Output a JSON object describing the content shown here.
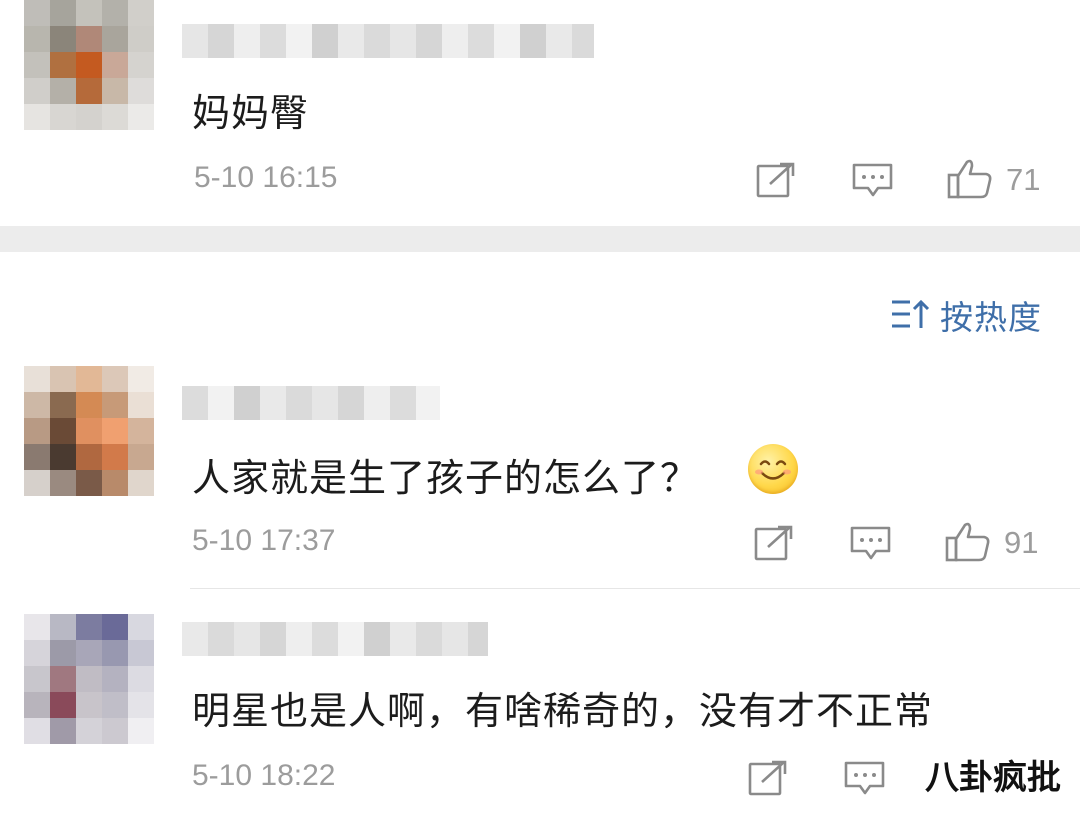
{
  "comments": [
    {
      "text": "妈妈臀",
      "time": "5-10 16:15",
      "likes": "71",
      "avatar_colors": [
        "#bfbdb8",
        "#a6a49c",
        "#c4c2bb",
        "#b3b1aa",
        "#d1cfca",
        "#b8b6ae",
        "#8b857a",
        "#b08878",
        "#a9a59c",
        "#cfcdc8",
        "#c3c1bb",
        "#b07040",
        "#c45a20",
        "#c9a898",
        "#d5d3cf",
        "#d0ceca",
        "#b4b0a8",
        "#b56a3a",
        "#c8b8a8",
        "#dedcda",
        "#e6e4e1",
        "#d8d6d2",
        "#d4d2ce",
        "#dcdad6",
        "#ebeae8"
      ]
    },
    {
      "text": "人家就是生了孩子的怎么了？",
      "time": "5-10 17:37",
      "likes": "91",
      "avatar_colors": [
        "#e8e0d8",
        "#d9c4b2",
        "#e2b896",
        "#dcc8b8",
        "#f1ebe5",
        "#cdb8a6",
        "#8a6a50",
        "#d48a54",
        "#c79a78",
        "#eadfd5",
        "#b89a84",
        "#6a4a36",
        "#e09060",
        "#f0a070",
        "#d4b49c",
        "#8a7a70",
        "#4a3a30",
        "#b06840",
        "#d27a4a",
        "#c8a890",
        "#d6d0cb",
        "#9a8a80",
        "#7a5a48",
        "#b88a6a",
        "#e0d6cc"
      ]
    },
    {
      "text": "明星也是人啊，有啥稀奇的，没有才不正常",
      "time": "5-10 18:22",
      "likes": "",
      "avatar_colors": [
        "#e8e6ea",
        "#b8b8c4",
        "#7c7ca0",
        "#6a6a98",
        "#d8d8e0",
        "#d6d4da",
        "#9c9aa8",
        "#a8a6b8",
        "#9898b0",
        "#c8c8d4",
        "#c8c6cc",
        "#a07880",
        "#c0bcc4",
        "#b4b2c0",
        "#dcdbe2",
        "#b8b4bc",
        "#8a4a5a",
        "#c8c4ca",
        "#c0bec8",
        "#e4e3e8",
        "#e0dee4",
        "#a09aa8",
        "#d4d2d8",
        "#ccc9d0",
        "#f0eff2"
      ]
    }
  ],
  "sort": {
    "label": "按热度"
  },
  "watermark": {
    "text": "八卦疯批"
  },
  "colors": {
    "accent": "#3f6fa9",
    "muted": "#9c9c9c",
    "band": "#ececec"
  },
  "icons": [
    "share-icon",
    "comment-icon",
    "like-icon",
    "sort-icon",
    "smile-emoji"
  ]
}
